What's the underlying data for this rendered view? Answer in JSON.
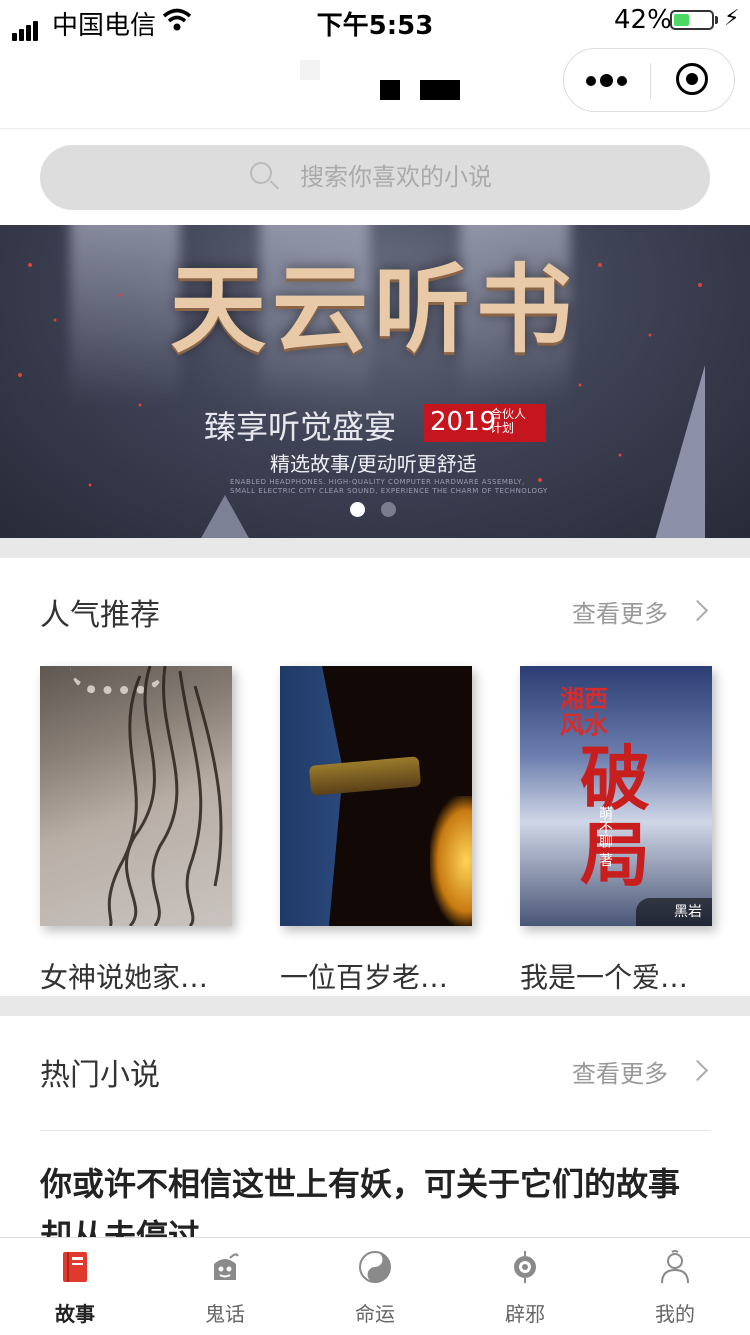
{
  "status_bar": {
    "carrier": "中国电信",
    "time": "下午5:53",
    "battery_pct": "42%",
    "battery_level": 0.42
  },
  "search": {
    "placeholder": "搜索你喜欢的小说"
  },
  "banner": {
    "title": "天云听书",
    "subtitle": "臻享听觉盛宴",
    "badge_year": "2019",
    "badge_tag": "合伙人计划",
    "slogan": "精选故事/更动听更舒适",
    "tiny_text": "ENABLED HEADPHONES. HIGH-QUALITY COMPUTER HARDWARE ASSEMBLY, SMALL ELECTRIC CITY CLEAR SOUND, EXPERIENCE THE CHARM OF TECHNOLOGY",
    "slides": 2,
    "active_slide": 0
  },
  "popular": {
    "title": "人气推荐",
    "more": "查看更多",
    "books": [
      {
        "title": "女神说她家…"
      },
      {
        "title": "一位百岁老…"
      },
      {
        "title": "我是一个爱…",
        "cover_title": "湘西风水破局",
        "cover_author": "萌不聊 著",
        "cover_publisher": "黑岩"
      }
    ]
  },
  "hot": {
    "title": "热门小说",
    "more": "查看更多",
    "story": "你或许不相信这世上有妖，可关于它们的故事却从未停过"
  },
  "tabs": [
    {
      "label": "故事",
      "icon": "book-icon",
      "active": true
    },
    {
      "label": "鬼话",
      "icon": "ghost-icon",
      "active": false
    },
    {
      "label": "命运",
      "icon": "yin-yang-icon",
      "active": false
    },
    {
      "label": "辟邪",
      "icon": "amulet-icon",
      "active": false
    },
    {
      "label": "我的",
      "icon": "user-icon",
      "active": false
    }
  ],
  "colors": {
    "accent": "#e03a2f",
    "banner_badge": "#c5161f",
    "battery": "#4cd964"
  }
}
